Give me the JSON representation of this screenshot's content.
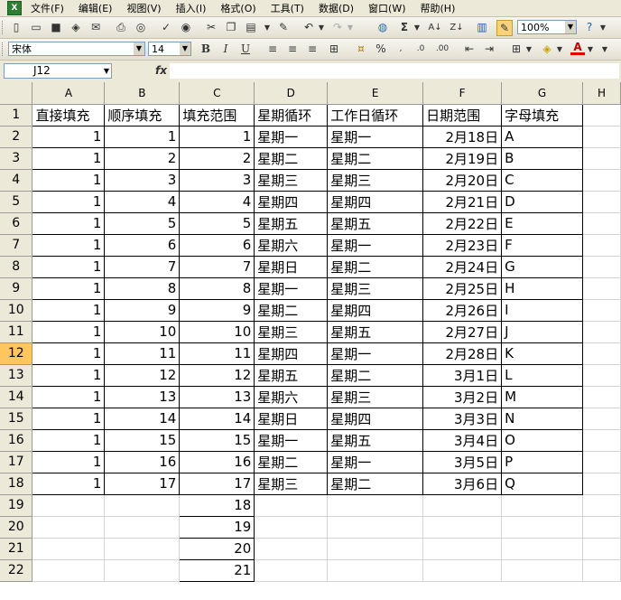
{
  "menu": [
    "文件(F)",
    "编辑(E)",
    "视图(V)",
    "插入(I)",
    "格式(O)",
    "工具(T)",
    "数据(D)",
    "窗口(W)",
    "帮助(H)"
  ],
  "toolbar": {
    "zoom": "100%",
    "font_name": "宋体",
    "font_size": "14",
    "bold": "B",
    "italic": "I",
    "underline": "U",
    "percent": "%",
    "sigma": "Σ"
  },
  "name_box": "J12",
  "fx_label": "fx",
  "columns": [
    "A",
    "B",
    "C",
    "D",
    "E",
    "F",
    "G",
    "H"
  ],
  "active_row": 12,
  "rows": [
    {
      "n": "1",
      "cells": [
        "直接填充",
        "顺序填充",
        "填充范围",
        "星期循环",
        "工作日循环",
        "日期范围",
        "字母填充"
      ]
    },
    {
      "n": "2",
      "cells": [
        "1",
        "1",
        "1",
        "星期一",
        "星期一",
        "2月18日",
        "A"
      ]
    },
    {
      "n": "3",
      "cells": [
        "1",
        "2",
        "2",
        "星期二",
        "星期二",
        "2月19日",
        "B"
      ]
    },
    {
      "n": "4",
      "cells": [
        "1",
        "3",
        "3",
        "星期三",
        "星期三",
        "2月20日",
        "C"
      ]
    },
    {
      "n": "5",
      "cells": [
        "1",
        "4",
        "4",
        "星期四",
        "星期四",
        "2月21日",
        "D"
      ]
    },
    {
      "n": "6",
      "cells": [
        "1",
        "5",
        "5",
        "星期五",
        "星期五",
        "2月22日",
        "E"
      ]
    },
    {
      "n": "7",
      "cells": [
        "1",
        "6",
        "6",
        "星期六",
        "星期一",
        "2月23日",
        "F"
      ]
    },
    {
      "n": "8",
      "cells": [
        "1",
        "7",
        "7",
        "星期日",
        "星期二",
        "2月24日",
        "G"
      ]
    },
    {
      "n": "9",
      "cells": [
        "1",
        "8",
        "8",
        "星期一",
        "星期三",
        "2月25日",
        "H"
      ]
    },
    {
      "n": "10",
      "cells": [
        "1",
        "9",
        "9",
        "星期二",
        "星期四",
        "2月26日",
        "I"
      ]
    },
    {
      "n": "11",
      "cells": [
        "1",
        "10",
        "10",
        "星期三",
        "星期五",
        "2月27日",
        "J"
      ]
    },
    {
      "n": "12",
      "cells": [
        "1",
        "11",
        "11",
        "星期四",
        "星期一",
        "2月28日",
        "K"
      ]
    },
    {
      "n": "13",
      "cells": [
        "1",
        "12",
        "12",
        "星期五",
        "星期二",
        "3月1日",
        "L"
      ]
    },
    {
      "n": "14",
      "cells": [
        "1",
        "13",
        "13",
        "星期六",
        "星期三",
        "3月2日",
        "M"
      ]
    },
    {
      "n": "15",
      "cells": [
        "1",
        "14",
        "14",
        "星期日",
        "星期四",
        "3月3日",
        "N"
      ]
    },
    {
      "n": "16",
      "cells": [
        "1",
        "15",
        "15",
        "星期一",
        "星期五",
        "3月4日",
        "O"
      ]
    },
    {
      "n": "17",
      "cells": [
        "1",
        "16",
        "16",
        "星期二",
        "星期一",
        "3月5日",
        "P"
      ]
    },
    {
      "n": "18",
      "cells": [
        "1",
        "17",
        "17",
        "星期三",
        "星期二",
        "3月6日",
        "Q"
      ]
    },
    {
      "n": "19",
      "cells": [
        "",
        "",
        "18",
        "",
        "",
        "",
        ""
      ]
    },
    {
      "n": "20",
      "cells": [
        "",
        "",
        "19",
        "",
        "",
        "",
        ""
      ]
    },
    {
      "n": "21",
      "cells": [
        "",
        "",
        "20",
        "",
        "",
        "",
        ""
      ]
    },
    {
      "n": "22",
      "cells": [
        "",
        "",
        "21",
        "",
        "",
        "",
        ""
      ]
    }
  ]
}
